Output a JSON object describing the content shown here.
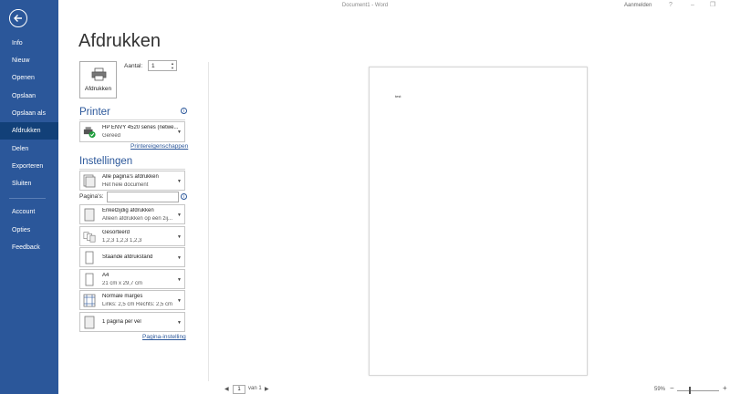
{
  "window": {
    "title": "Document1 - Word",
    "signin": "Aanmelden",
    "help": "?",
    "minimize": "–",
    "restore": "❐"
  },
  "nav": {
    "items": [
      {
        "label": "Info"
      },
      {
        "label": "Nieuw"
      },
      {
        "label": "Openen"
      },
      {
        "label": "Opslaan"
      },
      {
        "label": "Opslaan als"
      },
      {
        "label": "Afdrukken"
      },
      {
        "label": "Delen"
      },
      {
        "label": "Exporteren"
      },
      {
        "label": "Sluiten"
      },
      {
        "label": "Account"
      },
      {
        "label": "Opties"
      },
      {
        "label": "Feedback"
      }
    ],
    "active": "Afdrukken"
  },
  "print": {
    "heading": "Afdrukken",
    "button_label": "Afdrukken",
    "copies_label": "Aantal:",
    "copies_value": "1"
  },
  "printer": {
    "section_title": "Printer",
    "name": "HP ENVY 4520 series (netwe...",
    "status": "Gereed",
    "properties_link": "Printereigenschappen"
  },
  "settings": {
    "section_title": "Instellingen",
    "pages_label": "Pagina's:",
    "pages_value": "",
    "dropdowns": [
      {
        "line1": "Alle pagina's afdrukken",
        "line2": "Het hele document"
      },
      {
        "line1": "Enkelzijdig afdrukken",
        "line2": "Alleen afdrukken op één zij..."
      },
      {
        "line1": "Gesorteerd",
        "line2": "1,2,3    1,2,3    1,2,3"
      },
      {
        "line1": "Staande afdrukstand",
        "line2": ""
      },
      {
        "line1": "A4",
        "line2": "21 cm x 29,7 cm"
      },
      {
        "line1": "Normale marges",
        "line2": "Links: 2,5 cm  Rechts: 2,5 cm"
      },
      {
        "line1": "1 pagina per vel",
        "line2": ""
      }
    ],
    "page_setup_link": "Pagina-instelling"
  },
  "preview": {
    "page_text": "test",
    "current_page": "1",
    "of_pages": "van 1",
    "zoom": "59%"
  },
  "colors": {
    "nav_bg": "#2b579a",
    "nav_active": "#124078",
    "accent": "#2b579a"
  }
}
